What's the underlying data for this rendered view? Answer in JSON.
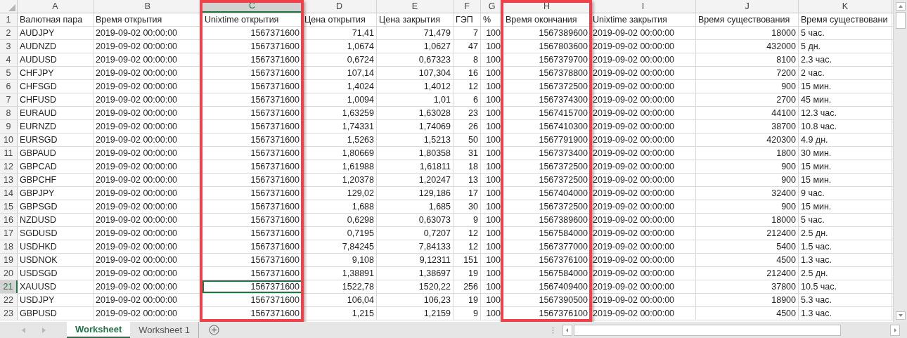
{
  "columns": [
    {
      "letter": "A",
      "kind": "text",
      "selected": false,
      "highlighted": false
    },
    {
      "letter": "B",
      "kind": "text",
      "selected": false,
      "highlighted": false
    },
    {
      "letter": "C",
      "kind": "number",
      "selected": true,
      "highlighted": true
    },
    {
      "letter": "D",
      "kind": "number",
      "selected": false,
      "highlighted": false
    },
    {
      "letter": "E",
      "kind": "number",
      "selected": false,
      "highlighted": false
    },
    {
      "letter": "F",
      "kind": "number",
      "selected": false,
      "highlighted": false
    },
    {
      "letter": "G",
      "kind": "number",
      "selected": false,
      "highlighted": false
    },
    {
      "letter": "H",
      "kind": "number",
      "selected": false,
      "highlighted": true
    },
    {
      "letter": "I",
      "kind": "text",
      "selected": false,
      "highlighted": false
    },
    {
      "letter": "J",
      "kind": "number",
      "selected": false,
      "highlighted": false
    },
    {
      "letter": "K",
      "kind": "text",
      "selected": false,
      "highlighted": false
    }
  ],
  "rows": [
    {
      "number": "1",
      "kind": "header",
      "selected": false,
      "cells": [
        "Валютная пара",
        "Время открытия",
        "Unixtime открытия",
        "Цена открытия",
        "Цена закрытия",
        "ГЭП",
        "%",
        "Время окончания",
        "Unixtime закрытия",
        "Время существования",
        "Время существовани"
      ]
    },
    {
      "number": "2",
      "kind": "data",
      "selected": false,
      "cells": [
        "AUDJPY",
        "2019-09-02 00:00:00",
        "1567371600",
        "71,41",
        "71,479",
        "7",
        "100",
        "1567389600",
        "2019-09-02 00:00:00",
        "18000",
        "5 час."
      ]
    },
    {
      "number": "3",
      "kind": "data",
      "selected": false,
      "cells": [
        "AUDNZD",
        "2019-09-02 00:00:00",
        "1567371600",
        "1,0674",
        "1,0627",
        "47",
        "100",
        "1567803600",
        "2019-09-02 00:00:00",
        "432000",
        "5 дн."
      ]
    },
    {
      "number": "4",
      "kind": "data",
      "selected": false,
      "cells": [
        "AUDUSD",
        "2019-09-02 00:00:00",
        "1567371600",
        "0,6724",
        "0,67323",
        "8",
        "100",
        "1567379700",
        "2019-09-02 00:00:00",
        "8100",
        "2.3 час."
      ]
    },
    {
      "number": "5",
      "kind": "data",
      "selected": false,
      "cells": [
        "CHFJPY",
        "2019-09-02 00:00:00",
        "1567371600",
        "107,14",
        "107,304",
        "16",
        "100",
        "1567378800",
        "2019-09-02 00:00:00",
        "7200",
        "2 час."
      ]
    },
    {
      "number": "6",
      "kind": "data",
      "selected": false,
      "cells": [
        "CHFSGD",
        "2019-09-02 00:00:00",
        "1567371600",
        "1,4024",
        "1,4012",
        "12",
        "100",
        "1567372500",
        "2019-09-02 00:00:00",
        "900",
        "15 мин."
      ]
    },
    {
      "number": "7",
      "kind": "data",
      "selected": false,
      "cells": [
        "CHFUSD",
        "2019-09-02 00:00:00",
        "1567371600",
        "1,0094",
        "1,01",
        "6",
        "100",
        "1567374300",
        "2019-09-02 00:00:00",
        "2700",
        "45 мин."
      ]
    },
    {
      "number": "8",
      "kind": "data",
      "selected": false,
      "cells": [
        "EURAUD",
        "2019-09-02 00:00:00",
        "1567371600",
        "1,63259",
        "1,63028",
        "23",
        "100",
        "1567415700",
        "2019-09-02 00:00:00",
        "44100",
        "12.3 час."
      ]
    },
    {
      "number": "9",
      "kind": "data",
      "selected": false,
      "cells": [
        "EURNZD",
        "2019-09-02 00:00:00",
        "1567371600",
        "1,74331",
        "1,74069",
        "26",
        "100",
        "1567410300",
        "2019-09-02 00:00:00",
        "38700",
        "10.8 час."
      ]
    },
    {
      "number": "10",
      "kind": "data",
      "selected": false,
      "cells": [
        "EURSGD",
        "2019-09-02 00:00:00",
        "1567371600",
        "1,5263",
        "1,5213",
        "50",
        "100",
        "1567791900",
        "2019-09-02 00:00:00",
        "420300",
        "4.9 дн."
      ]
    },
    {
      "number": "11",
      "kind": "data",
      "selected": false,
      "cells": [
        "GBPAUD",
        "2019-09-02 00:00:00",
        "1567371600",
        "1,80669",
        "1,80358",
        "31",
        "100",
        "1567373400",
        "2019-09-02 00:00:00",
        "1800",
        "30 мин."
      ]
    },
    {
      "number": "12",
      "kind": "data",
      "selected": false,
      "cells": [
        "GBPCAD",
        "2019-09-02 00:00:00",
        "1567371600",
        "1,61988",
        "1,61811",
        "18",
        "100",
        "1567372500",
        "2019-09-02 00:00:00",
        "900",
        "15 мин."
      ]
    },
    {
      "number": "13",
      "kind": "data",
      "selected": false,
      "cells": [
        "GBPCHF",
        "2019-09-02 00:00:00",
        "1567371600",
        "1,20378",
        "1,20247",
        "13",
        "100",
        "1567372500",
        "2019-09-02 00:00:00",
        "900",
        "15 мин."
      ]
    },
    {
      "number": "14",
      "kind": "data",
      "selected": false,
      "cells": [
        "GBPJPY",
        "2019-09-02 00:00:00",
        "1567371600",
        "129,02",
        "129,186",
        "17",
        "100",
        "1567404000",
        "2019-09-02 00:00:00",
        "32400",
        "9 час."
      ]
    },
    {
      "number": "15",
      "kind": "data",
      "selected": false,
      "cells": [
        "GBPSGD",
        "2019-09-02 00:00:00",
        "1567371600",
        "1,688",
        "1,685",
        "30",
        "100",
        "1567372500",
        "2019-09-02 00:00:00",
        "900",
        "15 мин."
      ]
    },
    {
      "number": "16",
      "kind": "data",
      "selected": false,
      "cells": [
        "NZDUSD",
        "2019-09-02 00:00:00",
        "1567371600",
        "0,6298",
        "0,63073",
        "9",
        "100",
        "1567389600",
        "2019-09-02 00:00:00",
        "18000",
        "5 час."
      ]
    },
    {
      "number": "17",
      "kind": "data",
      "selected": false,
      "cells": [
        "SGDUSD",
        "2019-09-02 00:00:00",
        "1567371600",
        "0,7195",
        "0,7207",
        "12",
        "100",
        "1567584000",
        "2019-09-02 00:00:00",
        "212400",
        "2.5 дн."
      ]
    },
    {
      "number": "18",
      "kind": "data",
      "selected": false,
      "cells": [
        "USDHKD",
        "2019-09-02 00:00:00",
        "1567371600",
        "7,84245",
        "7,84133",
        "12",
        "100",
        "1567377000",
        "2019-09-02 00:00:00",
        "5400",
        "1.5 час."
      ]
    },
    {
      "number": "19",
      "kind": "data",
      "selected": false,
      "cells": [
        "USDNOK",
        "2019-09-02 00:00:00",
        "1567371600",
        "9,108",
        "9,12311",
        "151",
        "100",
        "1567376100",
        "2019-09-02 00:00:00",
        "4500",
        "1.3 час."
      ]
    },
    {
      "number": "20",
      "kind": "data",
      "selected": false,
      "cells": [
        "USDSGD",
        "2019-09-02 00:00:00",
        "1567371600",
        "1,38891",
        "1,38697",
        "19",
        "100",
        "1567584000",
        "2019-09-02 00:00:00",
        "212400",
        "2.5 дн."
      ]
    },
    {
      "number": "21",
      "kind": "data",
      "selected": true,
      "cells": [
        "XAUUSD",
        "2019-09-02 00:00:00",
        "1567371600",
        "1522,78",
        "1520,22",
        "256",
        "100",
        "1567409400",
        "2019-09-02 00:00:00",
        "37800",
        "10.5 час."
      ]
    },
    {
      "number": "22",
      "kind": "data",
      "selected": false,
      "cells": [
        "USDJPY",
        "2019-09-02 00:00:00",
        "1567371600",
        "106,04",
        "106,23",
        "19",
        "100",
        "1567390500",
        "2019-09-02 00:00:00",
        "18900",
        "5.3 час."
      ]
    },
    {
      "number": "23",
      "kind": "data",
      "selected": false,
      "cells": [
        "GBPUSD",
        "2019-09-02 00:00:00",
        "1567371600",
        "1,215",
        "1,2159",
        "9",
        "100",
        "1567376100",
        "2019-09-02 00:00:00",
        "4500",
        "1.3 час."
      ]
    }
  ],
  "sheet_tabs": [
    {
      "label": "Worksheet",
      "selected": true
    },
    {
      "label": "Worksheet 1",
      "selected": false
    }
  ]
}
